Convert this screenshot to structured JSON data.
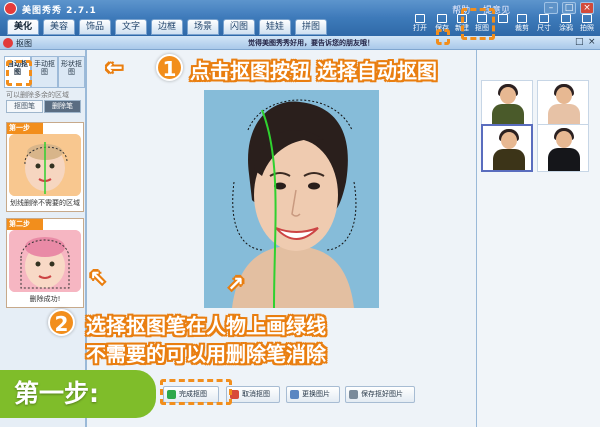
{
  "app": {
    "title": "美图秀秀 2.7.1",
    "links": [
      "帮助",
      "提意见"
    ],
    "controls": [
      "–",
      "□",
      "×"
    ]
  },
  "menu_tabs": [
    "美化",
    "美容",
    "饰品",
    "文字",
    "边框",
    "场景",
    "闪图",
    "娃娃",
    "拼图"
  ],
  "toolbar": [
    "打开",
    "保存",
    "新建",
    "抠图",
    "",
    "裁剪",
    "尺寸",
    "涂鸦",
    "拍照"
  ],
  "subwindow": {
    "title": "抠图",
    "promo": "觉得美图秀秀好用，要告诉您的朋友哦！",
    "controls": [
      "□",
      "×"
    ]
  },
  "left_panel": {
    "tabs": [
      "自动抠图",
      "手动抠图",
      "形状抠图"
    ],
    "hint": "可以删除多余的区域",
    "brushes": [
      "抠图笔",
      "删除笔"
    ],
    "steps": [
      {
        "head": "第一步",
        "caption": "划线删除不需要的区域"
      },
      {
        "head": "第二步",
        "caption": "删除成功!"
      }
    ]
  },
  "annotations": {
    "step1_num": "1",
    "step1_text": "点击抠图按钮 选择自动抠图",
    "step2_num": "2",
    "step2_line1": "选择抠图笔在人物上画绿线",
    "step2_line2": "不需要的可以用删除笔消除",
    "banner": "第一步:"
  },
  "bottom_buttons": [
    "完成抠图",
    "取消抠图",
    "更换图片",
    "保存抠好图片"
  ],
  "colors": {
    "accent_orange": "#f28e1c",
    "banner_green": "#7fbd2a",
    "title_blue": "#3f7bbb"
  }
}
